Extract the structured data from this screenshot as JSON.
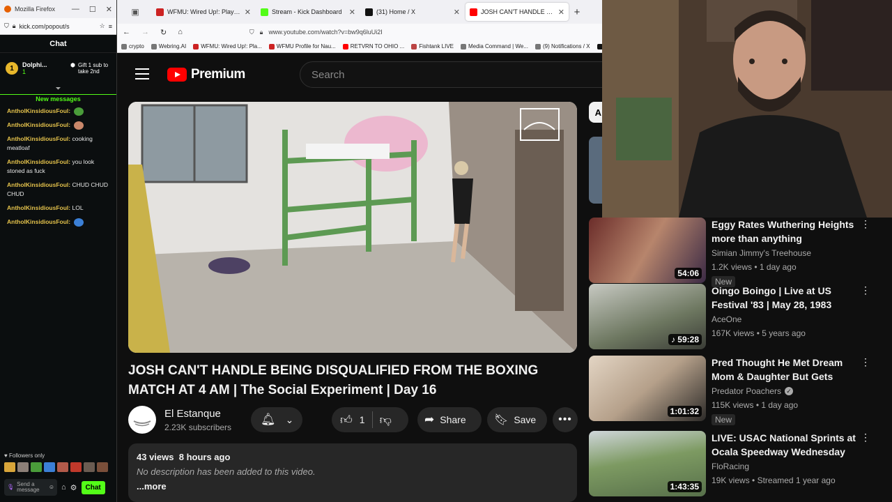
{
  "popout": {
    "window_title": "Mozilla Firefox",
    "url": "kick.com/popout/s",
    "chat_title": "Chat",
    "pinned_user": "Dolphi...",
    "pinned_count": "1",
    "pinned_badge": "1",
    "gift_text": "Gift 1 sub to take 2nd",
    "new_messages": "New messages",
    "messages": [
      {
        "user": "AntholKinsidiousFoul:",
        "text": ""
      },
      {
        "user": "AntholKinsidiousFoul:",
        "text": ""
      },
      {
        "user": "AntholKinsidiousFoul:",
        "text": "cooking meatloaf"
      },
      {
        "user": "AntholKinsidiousFoul:",
        "text": "you look stoned as fuck"
      },
      {
        "user": "AntholKinsidiousFoul:",
        "text": "CHUD CHUD CHUD"
      },
      {
        "user": "AntholKinsidiousFoul:",
        "text": "LOL"
      },
      {
        "user": "AntholKinsidiousFoul:",
        "text": ""
      }
    ],
    "followers_only": "Followers only",
    "input_placeholder": "Send a message",
    "chat_button": "Chat"
  },
  "browser": {
    "tabs": [
      {
        "label": "WFMU: Wired Up!: Playlist from",
        "color": "#cc2222"
      },
      {
        "label": "Stream - Kick Dashboard",
        "color": "#53fc18"
      },
      {
        "label": "(31) Home / X",
        "color": "#111111"
      },
      {
        "label": "JOSH CAN'T HANDLE BEIN",
        "color": "#ff0000"
      }
    ],
    "url": "www.youtube.com/watch?v=bw9q6luUi2I",
    "bookmarks": [
      "crypto",
      "Webring.AI",
      "WFMU: Wired Up!: Pla...",
      "WFMU Profile for Nau...",
      "RETVRN TO OHIO ...",
      "Fishtank LIVE",
      "Media Command | We...",
      "(9) Notifications / X"
    ]
  },
  "youtube": {
    "brand": "Premium",
    "search_placeholder": "Search",
    "video_title": "JOSH CAN'T HANDLE BEING DISQUALIFIED FROM THE BOXING MATCH AT 4 AM | The Social Experiment | Day 16",
    "channel_name": "El Estanque",
    "subscribers": "2.23K subscribers",
    "likes": "1",
    "share_label": "Share",
    "save_label": "Save",
    "views": "43 views",
    "posted": "8 hours ago",
    "description": "No description has been added to this video.",
    "more_label": "...more",
    "chip_letter": "A"
  },
  "related": [
    {
      "title": "Eggy Rates Wuthering Heights more than anything",
      "channel": "Simian Jimmy's Treehouse",
      "views": "1.2K views",
      "age": "1 day ago",
      "duration": "54:06",
      "badge": "New",
      "verified": false
    },
    {
      "title": "Oingo Boingo | Live at US Festival '83 | May 28, 1983",
      "channel": "AceOne",
      "views": "167K views",
      "age": "5 years ago",
      "duration": "59:28",
      "badge": "",
      "verified": false
    },
    {
      "title": "Pred Thought He Met Dream Mom & Daughter But Gets Fac...",
      "channel": "Predator Poachers",
      "views": "115K views",
      "age": "1 day ago",
      "duration": "1:01:32",
      "badge": "New",
      "verified": true
    },
    {
      "title": "LIVE: USAC National Sprints at Ocala Speedway Wednesday",
      "channel": "FloRacing",
      "views": "19K views",
      "age": "Streamed 1 year ago",
      "duration": "1:43:35",
      "badge": "",
      "verified": false
    }
  ]
}
